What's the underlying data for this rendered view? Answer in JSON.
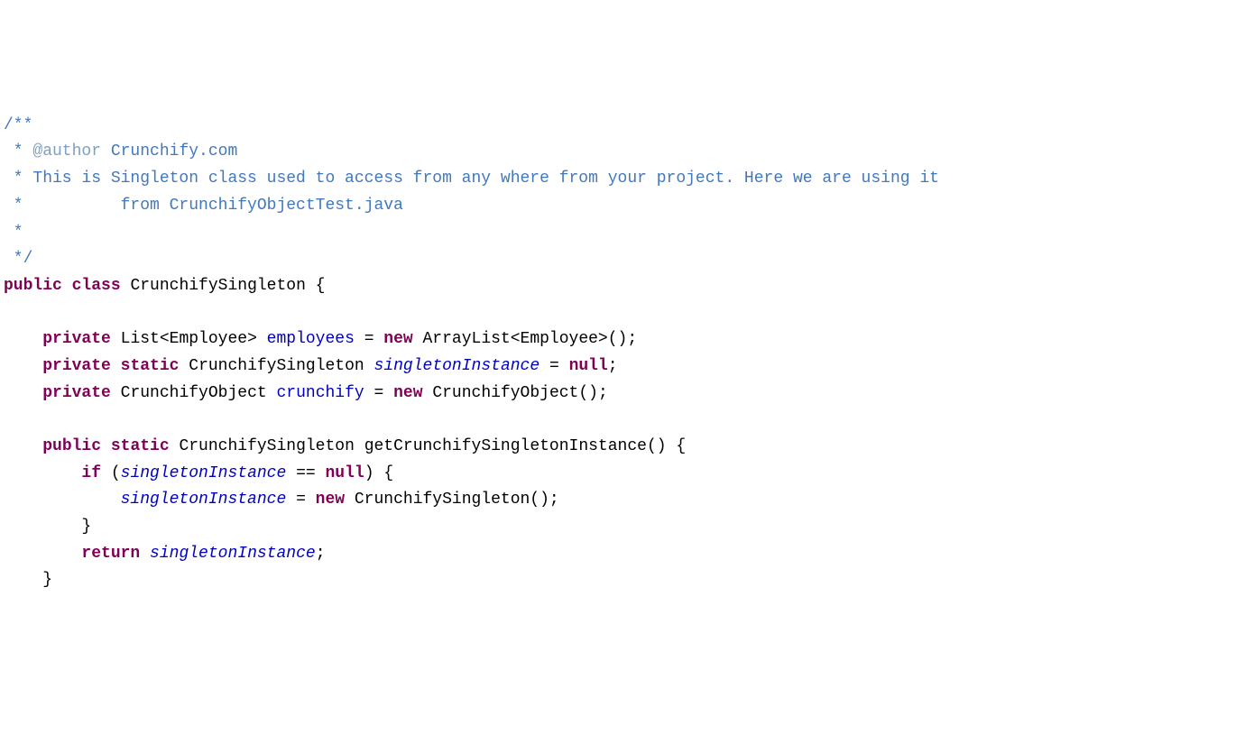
{
  "code": {
    "l1": {
      "a": "/**"
    },
    "l2": {
      "a": " * ",
      "b": "@author",
      "c": " Crunchify.com"
    },
    "l3": {
      "a": " * This is Singleton class used to access from any where from your project. Here we are using it"
    },
    "l4": {
      "a": " *          from CrunchifyObjectTest.java"
    },
    "l5": {
      "a": " *"
    },
    "l6": {
      "a": " */"
    },
    "l7": {
      "a": "public",
      "b": " ",
      "c": "class",
      "d": " CrunchifySingleton {"
    },
    "l8": {
      "a": ""
    },
    "l9": {
      "a": "    ",
      "b": "private",
      "c": " List<Employee> ",
      "d": "employees",
      "e": " = ",
      "f": "new",
      "g": " ArrayList<Employee>();"
    },
    "l10": {
      "a": "    ",
      "b": "private",
      "c": " ",
      "d": "static",
      "e": " CrunchifySingleton ",
      "f": "singletonInstance",
      "g": " = ",
      "h": "null",
      "i": ";"
    },
    "l11": {
      "a": "    ",
      "b": "private",
      "c": " CrunchifyObject ",
      "d": "crunchify",
      "e": " = ",
      "f": "new",
      "g": " CrunchifyObject();"
    },
    "l12": {
      "a": ""
    },
    "l13": {
      "a": "    ",
      "b": "public",
      "c": " ",
      "d": "static",
      "e": " CrunchifySingleton getCrunchifySingletonInstance() {"
    },
    "l14": {
      "a": "        ",
      "b": "if",
      "c": " (",
      "d": "singletonInstance",
      "e": " == ",
      "f": "null",
      "g": ") {"
    },
    "l15": {
      "a": "            ",
      "b": "singletonInstance",
      "c": " = ",
      "d": "new",
      "e": " CrunchifySingleton();"
    },
    "l16": {
      "a": "        }"
    },
    "l17": {
      "a": "        ",
      "b": "return",
      "c": " ",
      "d": "singletonInstance",
      "e": ";"
    },
    "l18": {
      "a": "    }"
    }
  }
}
